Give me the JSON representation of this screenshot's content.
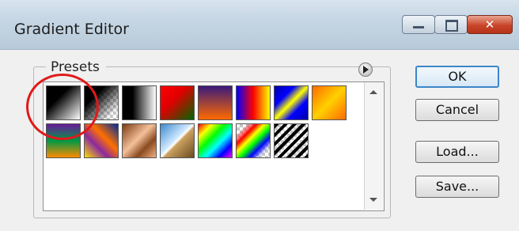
{
  "window": {
    "title": "Gradient Editor"
  },
  "presets": {
    "label": "Presets",
    "swatches": [
      {
        "name": "foreground-to-background",
        "css": "linear-gradient(135deg,#000 0%,#000 35%,#fff 100%)"
      },
      {
        "name": "foreground-to-transparent",
        "css": "linear-gradient(135deg,#000 0%,#000 30%,rgba(0,0,0,0) 85%)",
        "transparent": true
      },
      {
        "name": "black-white",
        "css": "linear-gradient(90deg,#000 0%,#000 30%,#fff 100%)"
      },
      {
        "name": "red-green",
        "css": "linear-gradient(135deg,#ff0000 0%,#e00000 40%,#006600 100%)"
      },
      {
        "name": "violet-orange",
        "css": "linear-gradient(180deg,#3a1a7a 0%,#ff6a00 100%)"
      },
      {
        "name": "blue-red-yellow",
        "css": "linear-gradient(90deg,#0000ff 0%,#ff0000 50%,#ffff00 100%)"
      },
      {
        "name": "blue-yellow-blue",
        "css": "linear-gradient(135deg,#0000aa 0%,#0000ff 30%,#ffff00 50%,#0000ff 70%,#0000aa 100%)"
      },
      {
        "name": "orange-yellow-orange",
        "css": "linear-gradient(135deg,#ff6a00 0%,#ffd000 50%,#ff6a00 100%)"
      },
      {
        "name": "violet-green-orange",
        "css": "linear-gradient(180deg,#6a1a9a 0%,#009944 50%,#ff8a00 100%)"
      },
      {
        "name": "yellow-violet-orange-blue",
        "css": "linear-gradient(45deg,#ffe000 0%,#8a2aa0 35%,#ff7000 60%,#002a9a 100%)"
      },
      {
        "name": "copper",
        "css": "linear-gradient(135deg,#7a3a10 0%,#f4c09a 45%,#8a4a20 70%,#f0b080 100%)"
      },
      {
        "name": "chrome",
        "css": "linear-gradient(135deg,#3a8ad0 0%,#cfe8ff 45%,#ffffff 50%,#caa060 55%,#6a4a20 100%)"
      },
      {
        "name": "spectrum",
        "css": "linear-gradient(135deg,#ff0000 0%,#ffff00 20%,#00ff00 40%,#00ffff 60%,#0000ff 80%,#ff00ff 100%)"
      },
      {
        "name": "transparent-rainbow",
        "css": "linear-gradient(135deg,rgba(255,0,0,0) 15%,#ff0000 30%,#ffff00 42%,#00ff00 55%,#0000ff 70%,rgba(255,0,255,0) 85%)",
        "transparent": true
      },
      {
        "name": "transparent-stripes",
        "css": "repeating-linear-gradient(135deg,#000 0px,#000 4px,rgba(0,0,0,0) 4px,rgba(0,0,0,0) 8px)",
        "transparent": true
      }
    ]
  },
  "buttons": {
    "ok": "OK",
    "cancel": "Cancel",
    "load": "Load...",
    "save": "Save..."
  },
  "annotation": {
    "color": "#e01a1a"
  }
}
